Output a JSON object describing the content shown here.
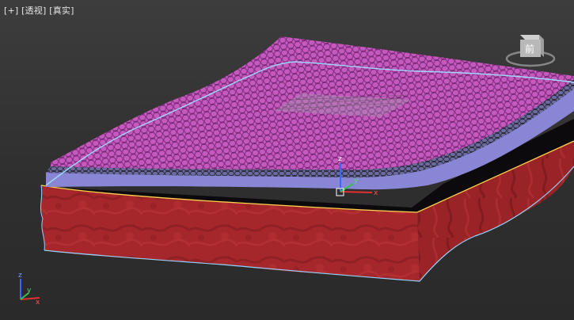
{
  "viewport": {
    "menu_plus": "[+]",
    "menu_view": "[透视]",
    "menu_shading": "[真实]"
  },
  "viewcube": {
    "face_label": "前",
    "icon": "viewcube-icon"
  },
  "gizmo": {
    "x_label": "x",
    "y_label": "y",
    "z_label": "z"
  },
  "mini_axis": {
    "x_label": "x",
    "y_label": "y",
    "z_label": "z"
  },
  "colors": {
    "background": "#333333",
    "flesh": "#a3262a",
    "membrane_top": "#b04aa6",
    "membrane_layer": "#8a86d6",
    "selection_edge": "#ffd34d",
    "cyan_edge": "#8fd4ff",
    "axis_x": "#e03030",
    "axis_y": "#34c34a",
    "axis_z": "#3a68ff"
  }
}
